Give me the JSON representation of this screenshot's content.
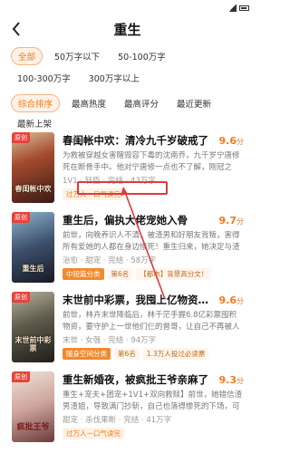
{
  "status_bar": {
    "time": "",
    "icons": [
      "signal-icon",
      "wifi-icon",
      "battery-icon"
    ]
  },
  "header": {
    "title": "重生",
    "back_icon": "chevron-left-icon"
  },
  "word_filters": [
    "全部",
    "50万字以下",
    "50-100万字",
    "100-300万字",
    "300万字以上"
  ],
  "active_word_filter": "全部",
  "sort_filters": [
    "综合排序",
    "最高热度",
    "最高评分",
    "最近更新",
    "最新上架"
  ],
  "active_sort_filter": "综合排序",
  "books": [
    {
      "cover_badge": "原创",
      "cover_title": "春闺帐中欢",
      "title": "春闺帐中欢：清冷九千岁破戒了",
      "score": "9.6",
      "score_unit": "分",
      "desc": "为救被穿越女害瞎毁容下毒的沈南乔，九千岁宁唐修死在断骨手中。他对宁唐修一点也不了解，刚冠之年，凉薄权臣红着眼：下辈子...",
      "meta": "1V1 · 轩臣 · 完结 · 43万字",
      "tags": [
        {
          "text": "过万人一口气读完",
          "type": "hot"
        }
      ]
    },
    {
      "cover_badge": "原创",
      "cover_title": "重生后",
      "title": "重生后，偏执大佬宠她入骨",
      "score": "9.7",
      "score_unit": "分",
      "desc": "前世，向晚养识人不清，被渣男和好朋友背叛，害得所有爱她的人都在身边惨死！重生归来，她决定与渣男断绝关系...",
      "meta": "治愈 · 甜宠 · 完结 · 58万字",
      "tags": [
        {
          "text": "中短篇分类",
          "type": "rank"
        },
        {
          "text": "第6名",
          "type": "rankinfo"
        },
        {
          "text": "【都市】背景高分文！",
          "type": "trend"
        }
      ]
    },
    {
      "cover_badge": "原创",
      "cover_title": "末世前中彩票",
      "title": "末世前中彩票，我囤上亿物资躺赢",
      "score": "9.6",
      "score_unit": "分",
      "desc": "前世，林卉末世降临后，林千茫手握6.8亿彩票囤积物资，要守护上一世他们仨的曾哥，让自己不再被人欺凌...",
      "meta": "末世 · 女强 · 完结 · 94万字",
      "tags": [
        {
          "text": "随身空间分类",
          "type": "rank"
        },
        {
          "text": "第6名",
          "type": "rankinfo"
        },
        {
          "text": "1.3万人投过必读票",
          "type": "trend"
        }
      ]
    },
    {
      "cover_badge": "原创",
      "cover_title": "疯批王爷",
      "title": "重生新婚夜，被疯批王爷亲麻了",
      "score": "9.3",
      "score_unit": "分",
      "desc": "重生+宠夫+团宠+1V1+双向救赎】前世，她错信渣男渣姐，导致满门抄斩，自己也落得惨死的下场，可笑...",
      "meta": "甜宠 · 杀伐果断 · 完结 · 41万字",
      "tags": [
        {
          "text": "过万人一口气读完",
          "type": "hot"
        }
      ]
    }
  ]
}
